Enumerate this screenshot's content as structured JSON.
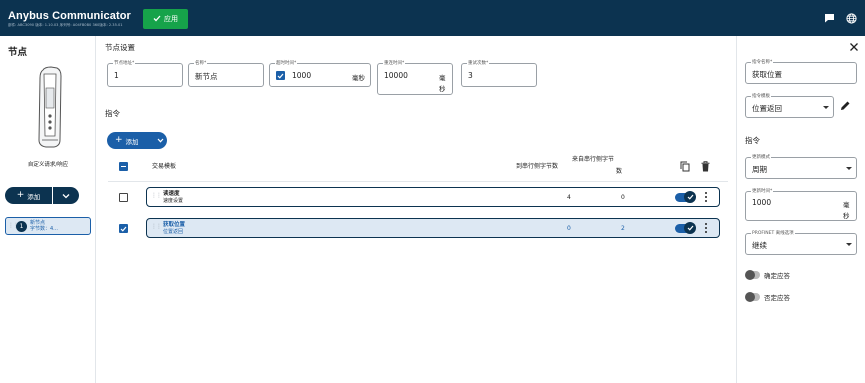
{
  "header": {
    "title": "Anybus Communicator",
    "version": "部件: ABC3090 版本: 1.10.03 序列号: A04FB0B0 360版本: 2.35.01",
    "apply_label": "应用"
  },
  "left": {
    "title": "节点",
    "device_label": "自定义请求/响应",
    "add_label": "添加",
    "node": {
      "number": "1",
      "name": "新节点",
      "detail": "字节数：4..."
    }
  },
  "main": {
    "settings_title": "节点设置",
    "fields": {
      "address": {
        "label": "节点地址*",
        "value": "1"
      },
      "name": {
        "label": "名称*",
        "value": "新节点"
      },
      "timeout": {
        "label": "超时时间*",
        "value": "1000",
        "unit": "毫秒",
        "checked": true
      },
      "retry_time": {
        "label": "重连时间*",
        "value": "10000",
        "unit1": "毫",
        "unit2": "秒"
      },
      "retries": {
        "label": "重试次数*",
        "value": "3"
      }
    },
    "instr_title": "指令",
    "add_label": "添加",
    "table": {
      "col_template": "交易模板",
      "col_to_serial": "到串行侧字节数",
      "col_from_serial_1": "来自串行侧字节",
      "col_from_serial_2": "数",
      "rows": [
        {
          "name": "读速度",
          "template": "速度设置",
          "to": "4",
          "from": "0",
          "checked": false,
          "enabled": true
        },
        {
          "name": "获取位置",
          "template": "位置返回",
          "to": "0",
          "from": "2",
          "checked": true,
          "enabled": true
        }
      ]
    }
  },
  "right": {
    "instr_name": {
      "label": "指令名称*",
      "value": "获取位置"
    },
    "instr_template": {
      "label": "指令模板",
      "value": "位置返回"
    },
    "section_title": "指令",
    "update_mode": {
      "label": "更新模式",
      "value": "周期"
    },
    "update_time": {
      "label": "更新时间*",
      "value": "1000",
      "unit1": "毫",
      "unit2": "秒"
    },
    "profinet": {
      "label": "PROFINET 离线选项",
      "value": "继续"
    },
    "ack_label": "确定应答",
    "nack_label": "否定应答"
  },
  "colors": {
    "navy": "#0c3350",
    "blue": "#1b5fa8",
    "green": "#16a34a"
  }
}
